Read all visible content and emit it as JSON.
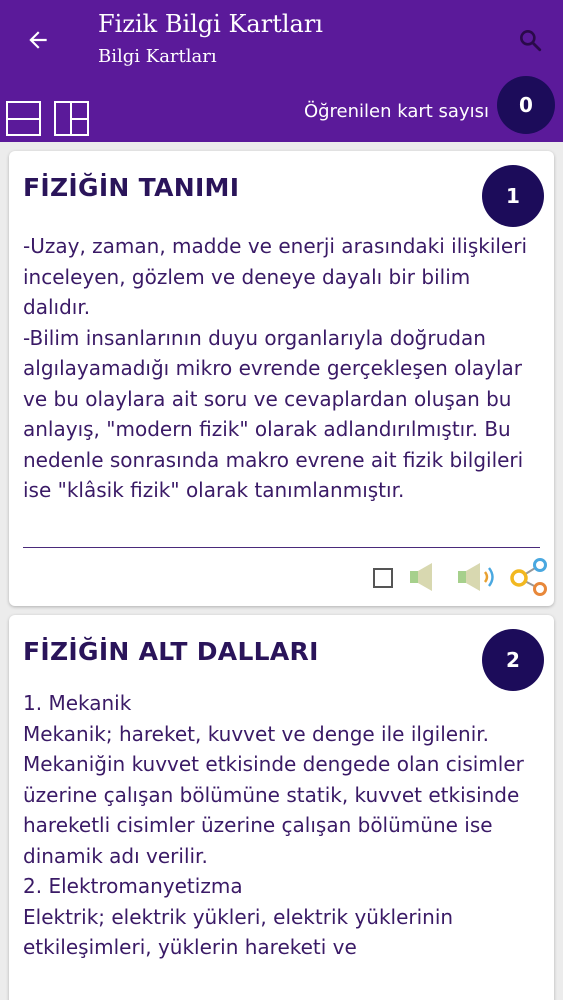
{
  "header": {
    "title": "Fizik Bilgi Kartları",
    "subtitle": "Bilgi Kartları",
    "learned_label": "Öğrenilen kart sayısı",
    "learned_count": "0"
  },
  "cards": [
    {
      "number": "1",
      "title": "FİZİĞİN TANIMI",
      "text": "-Uzay, zaman, madde ve enerji arasındaki ilişkileri inceleyen, gözlem ve deneye dayalı bir bilim dalıdır.\n-Bilim insanlarının duyu organlarıyla doğrudan algılayamadığı mikro evrende gerçekleşen olaylar ve bu olaylara ait soru ve cevaplardan oluşan bu anlayış, \"modern fizik\" olarak adlandırılmıştır. Bu nedenle sonrasında makro evrene ait fizik bilgileri ise \"klâsik fizik\" olarak tanımlanmıştır."
    },
    {
      "number": "2",
      "title": "FİZİĞİN ALT DALLARI",
      "text": "1. Mekanik\nMekanik; hareket, kuvvet ve denge ile ilgilenir. Mekaniğin kuvvet etkisinde dengede olan cisimler üzerine çalışan bölümüne statik, kuvvet etkisinde hareketli cisimler üzerine çalışan bölümüne ise dinamik adı verilir.\n2. Elektromanyetizma\nElektrik; elektrik yükleri, elektrik yüklerinin etkileşimleri, yüklerin hareketi ve"
    }
  ],
  "colors": {
    "appbar": "#5b1a9a",
    "badge": "#1c0c5a",
    "title_text": "#2a145a",
    "body_text": "#3a1a66",
    "speaker": "#b8d8a8",
    "share_yellow": "#f2b820",
    "share_orange": "#e8883a",
    "share_blue": "#4aa8e0"
  },
  "icons": {
    "back": "arrow-left-icon",
    "search": "search-icon",
    "layout_single": "single-card-layout-icon",
    "layout_split": "split-card-layout-icon",
    "checkbox": "checkbox-icon",
    "speaker_mute": "speaker-mute-icon",
    "speaker_sound": "speaker-sound-icon",
    "share": "share-icon"
  }
}
